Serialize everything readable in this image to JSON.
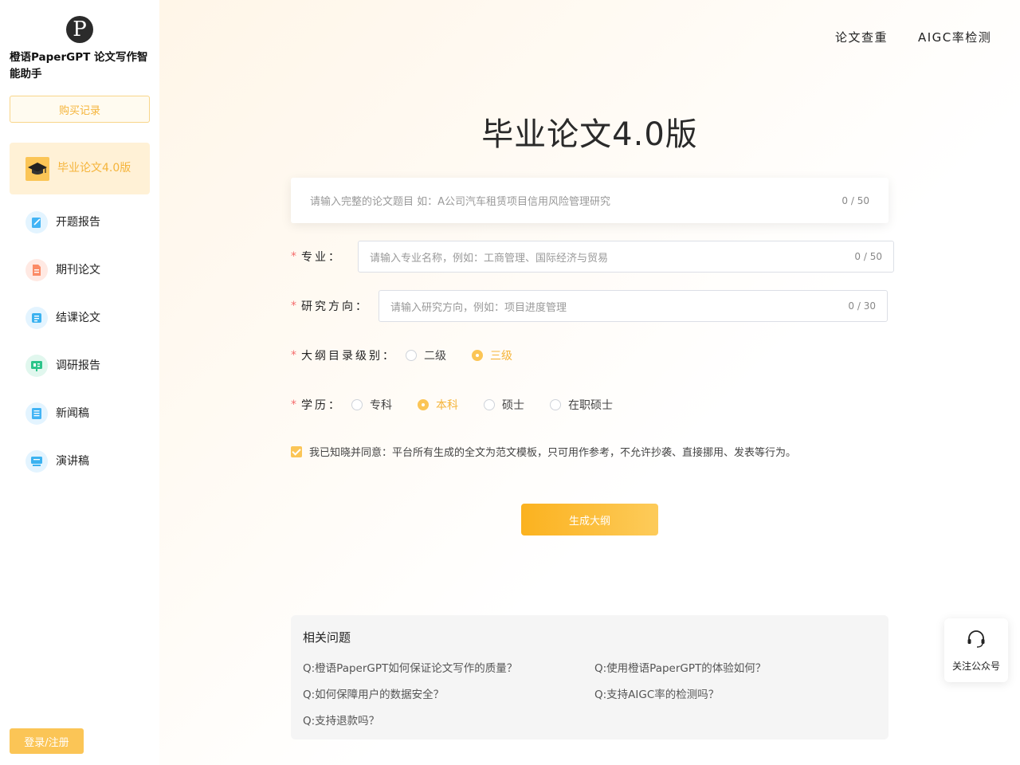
{
  "sidebar": {
    "logo_letter": "P",
    "brand": "橙语PaperGPT 论文写作智能助手",
    "buy_records": "购买记录",
    "items": [
      {
        "label": "毕业论文4.0版",
        "icon": "graduation-cap-icon",
        "active": true
      },
      {
        "label": "开题报告",
        "icon": "edit-note-icon"
      },
      {
        "label": "期刊论文",
        "icon": "document-icon"
      },
      {
        "label": "结课论文",
        "icon": "scroll-icon"
      },
      {
        "label": "调研报告",
        "icon": "presentation-board-icon"
      },
      {
        "label": "新闻稿",
        "icon": "news-icon"
      },
      {
        "label": "演讲稿",
        "icon": "speech-icon"
      }
    ],
    "login": "登录/注册"
  },
  "header": {
    "links": [
      "论文查重",
      "AIGC率检测"
    ]
  },
  "main": {
    "title": "毕业论文4.0版",
    "title_input": {
      "placeholder": "请输入完整的论文题目 如：A公司汽车租赁项目信用风险管理研究",
      "count": "0 / 50"
    },
    "major": {
      "label": "专业：",
      "placeholder": "请输入专业名称，例如：工商管理、国际经济与贸易",
      "count": "0 / 50"
    },
    "direction": {
      "label": "研究方向：",
      "placeholder": "请输入研究方向，例如：项目进度管理",
      "count": "0 / 30"
    },
    "outline_level": {
      "label": "大纲目录级别：",
      "options": [
        "二级",
        "三级"
      ],
      "selected": "三级"
    },
    "degree": {
      "label": "学历：",
      "options": [
        "专科",
        "本科",
        "硕士",
        "在职硕士"
      ],
      "selected": "本科"
    },
    "agree_text": "我已知晓并同意：平台所有生成的全文为范文模板，只可用作参考，不允许抄袭、直接挪用、发表等行为。",
    "generate_button": "生成大纲"
  },
  "faq": {
    "title": "相关问题",
    "questions": [
      "Q:橙语PaperGPT如何保证论文写作的质量？",
      "Q:使用橙语PaperGPT的体验如何？",
      "Q:如何保障用户的数据安全？",
      "Q:支持AIGC率的检测吗？",
      "Q:支持退款吗？"
    ]
  },
  "follow": {
    "label": "关注公众号",
    "icon": "headset-icon"
  },
  "colors": {
    "accent": "#fbc556",
    "accent_text": "#f5b43a",
    "required": "#f56c6c"
  }
}
